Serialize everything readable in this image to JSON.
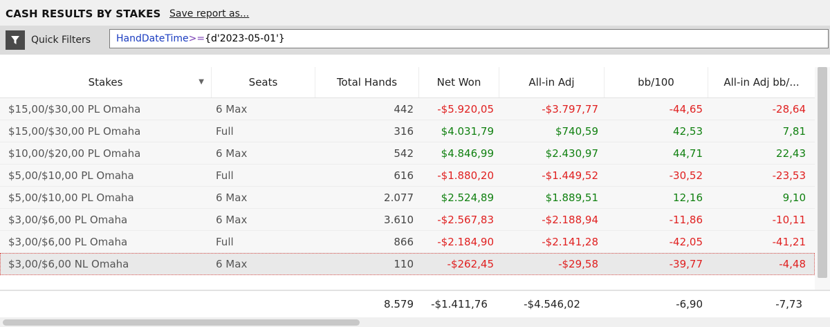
{
  "header": {
    "title": "CASH RESULTS BY STAKES",
    "save_link": "Save report as..."
  },
  "filter": {
    "label": "Quick Filters",
    "query_field": "HandDateTime",
    "query_operator": ">=",
    "query_value": "{d'2023-05-01'}"
  },
  "columns": {
    "stakes": "Stakes",
    "seats": "Seats",
    "total_hands": "Total Hands",
    "net_won": "Net Won",
    "allin_adj": "All-in Adj",
    "bb100": "bb/100",
    "allin_adj_bb100": "All-in Adj bb/..."
  },
  "rows": [
    {
      "stakes": "$15,00/$30,00 PL Omaha",
      "seats": "6 Max",
      "total_hands": "442",
      "net_won": "-$5.920,05",
      "allin_adj": "-$3.797,77",
      "bb100": "-44,65",
      "allin_adj_bb100": "-28,64"
    },
    {
      "stakes": "$15,00/$30,00 PL Omaha",
      "seats": "Full",
      "total_hands": "316",
      "net_won": "$4.031,79",
      "allin_adj": "$740,59",
      "bb100": "42,53",
      "allin_adj_bb100": "7,81"
    },
    {
      "stakes": "$10,00/$20,00 PL Omaha",
      "seats": "6 Max",
      "total_hands": "542",
      "net_won": "$4.846,99",
      "allin_adj": "$2.430,97",
      "bb100": "44,71",
      "allin_adj_bb100": "22,43"
    },
    {
      "stakes": "$5,00/$10,00 PL Omaha",
      "seats": "Full",
      "total_hands": "616",
      "net_won": "-$1.880,20",
      "allin_adj": "-$1.449,52",
      "bb100": "-30,52",
      "allin_adj_bb100": "-23,53"
    },
    {
      "stakes": "$5,00/$10,00 PL Omaha",
      "seats": "6 Max",
      "total_hands": "2.077",
      "net_won": "$2.524,89",
      "allin_adj": "$1.889,51",
      "bb100": "12,16",
      "allin_adj_bb100": "9,10"
    },
    {
      "stakes": "$3,00/$6,00 PL Omaha",
      "seats": "6 Max",
      "total_hands": "3.610",
      "net_won": "-$2.567,83",
      "allin_adj": "-$2.188,94",
      "bb100": "-11,86",
      "allin_adj_bb100": "-10,11"
    },
    {
      "stakes": "$3,00/$6,00 PL Omaha",
      "seats": "Full",
      "total_hands": "866",
      "net_won": "-$2.184,90",
      "allin_adj": "-$2.141,28",
      "bb100": "-42,05",
      "allin_adj_bb100": "-41,21"
    },
    {
      "stakes": "$3,00/$6,00 NL Omaha",
      "seats": "6 Max",
      "total_hands": "110",
      "net_won": "-$262,45",
      "allin_adj": "-$29,58",
      "bb100": "-39,77",
      "allin_adj_bb100": "-4,48"
    }
  ],
  "totals": {
    "total_hands": "8.579",
    "net_won": "-$1.411,76",
    "allin_adj": "-$4.546,02",
    "bb100": "-6,90",
    "allin_adj_bb100": "-7,73"
  },
  "colors": {
    "negative": "#e02020",
    "positive": "#108010"
  },
  "icons": {
    "filter": "funnel-icon",
    "sort": "sort-down-icon"
  }
}
